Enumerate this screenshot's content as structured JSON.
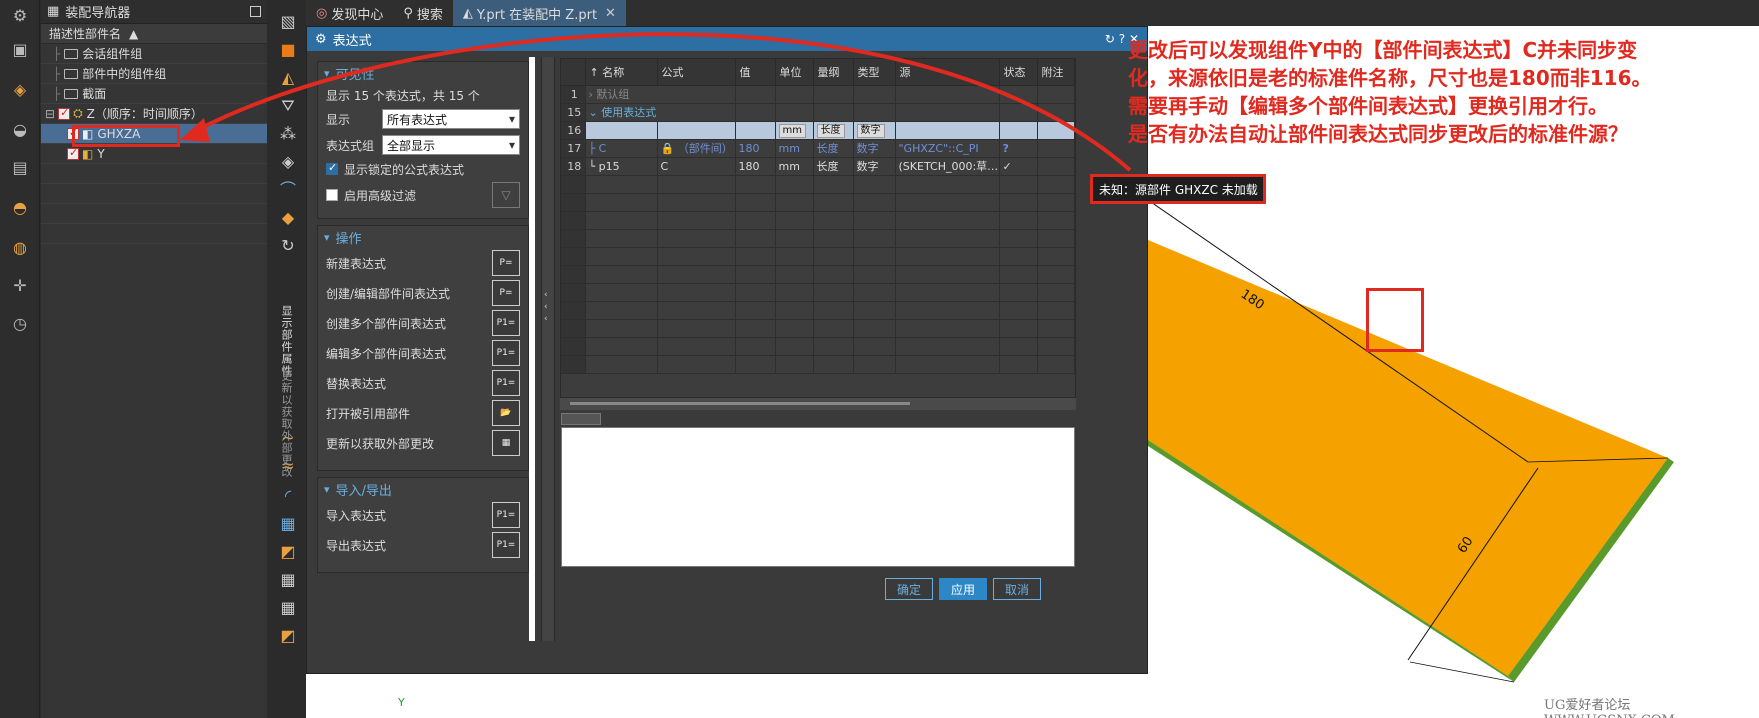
{
  "navigator": {
    "title": "装配导航器",
    "col_header": "描述性部件名",
    "rows": [
      {
        "label": "会话组件组"
      },
      {
        "label": "部件中的组件组"
      },
      {
        "label": "截面"
      },
      {
        "label": "Z（顺序：时间顺序）"
      },
      {
        "label": "GHXZA"
      },
      {
        "label": "Y"
      }
    ]
  },
  "tabs": [
    {
      "label": "发现中心"
    },
    {
      "label": "搜索"
    },
    {
      "label": "Y.prt 在装配中 Z.prt"
    }
  ],
  "resource_bar": {
    "vtext1": "显示部件属性",
    "vtext2": "更新以获取外部更改"
  },
  "dialog": {
    "title": "表达式",
    "title_controls": "↻ ? ✕",
    "visibility": {
      "header": "可见性",
      "summary": "显示 15 个表达式，共 15 个",
      "display_label": "显示",
      "display_value": "所有表达式",
      "group_label": "表达式组",
      "group_value": "全部显示",
      "show_locked": "显示锁定的公式表达式",
      "advanced_filter": "启用高级过滤"
    },
    "operations": {
      "header": "操作",
      "items": [
        {
          "label": "新建表达式",
          "icon": "P="
        },
        {
          "label": "创建/编辑部件间表达式",
          "icon": "P="
        },
        {
          "label": "创建多个部件间表达式",
          "icon": "P1="
        },
        {
          "label": "编辑多个部件间表达式",
          "icon": "P1="
        },
        {
          "label": "替换表达式",
          "icon": "P1="
        },
        {
          "label": "打开被引用部件",
          "icon": "📂"
        },
        {
          "label": "更新以获取外部更改",
          "icon": "▦"
        }
      ]
    },
    "import_export": {
      "header": "导入/导出",
      "items": [
        {
          "label": "导入表达式",
          "icon": "P1="
        },
        {
          "label": "导出表达式",
          "icon": "P1="
        }
      ]
    },
    "grid": {
      "columns": [
        "↑  名称",
        "公式",
        "值",
        "单位",
        "量纲",
        "类型",
        "源",
        "状态",
        "附注"
      ],
      "rows": [
        {
          "idx": "1",
          "name": "› 默认组",
          "kind": "group"
        },
        {
          "idx": "15",
          "name": "⌄ 使用表达式",
          "kind": "group2"
        },
        {
          "idx": "16",
          "name": "",
          "formula": "",
          "value": "",
          "unit": "mm",
          "dim": "长度",
          "type": "数字",
          "source": "",
          "kind": "hl"
        },
        {
          "idx": "17",
          "name": "  ├ C",
          "formula": "🔒 （部件间）",
          "value": "180",
          "unit": "mm",
          "dim": "长度",
          "type": "数字",
          "source": "\"GHXZC\"::C_PI",
          "status": "?",
          "kind": "blue"
        },
        {
          "idx": "18",
          "name": "  └ p15",
          "formula": "C",
          "value": "180",
          "unit": "mm",
          "dim": "长度",
          "type": "数字",
          "source": "(SKETCH_000:草…",
          "status": "✓",
          "kind": "norm"
        }
      ]
    },
    "buttons": {
      "ok": "确定",
      "apply": "应用",
      "cancel": "取消"
    }
  },
  "tooltip": "未知：源部件 GHXZC 未加载",
  "annotation": {
    "lines": [
      "更改后可以发现组件Y中的【部件间表达式】C并未同步变",
      "化，来源依旧是老的标准件名称，尺寸也是180而非116。",
      "需要再手动【编辑多个部件间表达式】更换引用才行。",
      "是否有办法自动让部件间表达式同步更改后的标准件源？"
    ]
  },
  "dims": {
    "long": "180",
    "short": "60"
  },
  "axis_label": "Y",
  "watermark": "UG爱好者论坛 WWW.UGSNX.COM",
  "colors": {
    "accent": "#2d6fa3",
    "plate": "#f5a100",
    "annotation": "#e02a20"
  }
}
